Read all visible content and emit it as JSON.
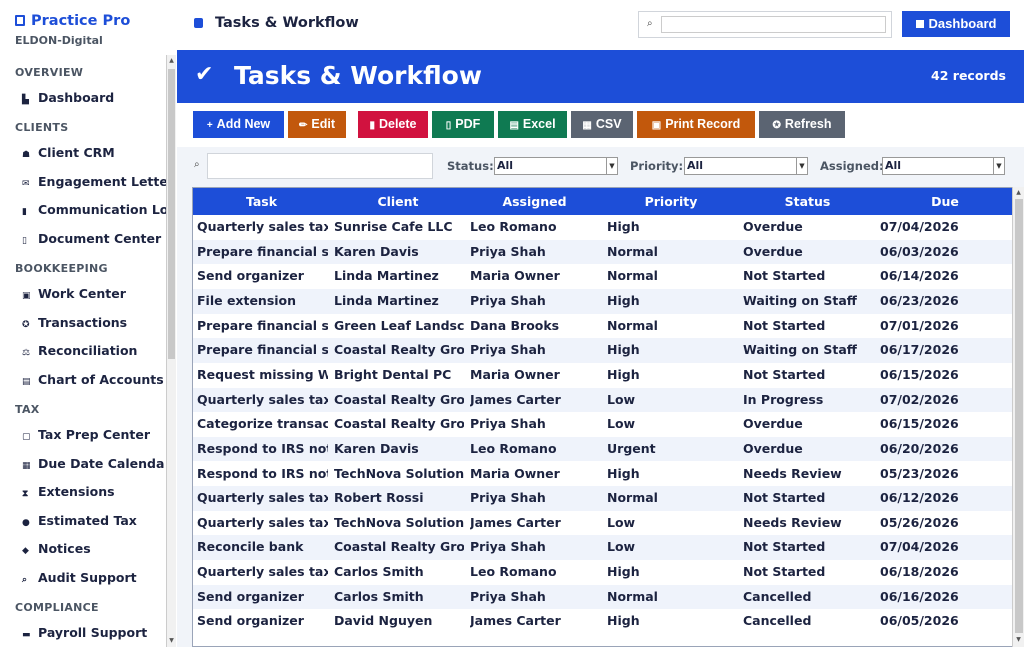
{
  "sidebar": {
    "brand": "Practice Pro",
    "org": "ELDON-Digital",
    "sections": [
      {
        "title": "OVERVIEW",
        "items": [
          {
            "label": "Dashboard",
            "icon": "chart-icon",
            "glyph": "▙"
          }
        ]
      },
      {
        "title": "CLIENTS",
        "items": [
          {
            "label": "Client CRM",
            "icon": "users-icon",
            "glyph": "☗"
          },
          {
            "label": "Engagement Lette",
            "icon": "envelope-icon",
            "glyph": "✉"
          },
          {
            "label": "Communication Lo",
            "icon": "message-icon",
            "glyph": "▮"
          },
          {
            "label": "Document Center",
            "icon": "document-icon",
            "glyph": "▯"
          }
        ]
      },
      {
        "title": "BOOKKEEPING",
        "items": [
          {
            "label": "Work Center",
            "icon": "clipboard-icon",
            "glyph": "▣"
          },
          {
            "label": "Transactions",
            "icon": "exchange-icon",
            "glyph": "✪"
          },
          {
            "label": "Reconciliation",
            "icon": "balance-icon",
            "glyph": "⚖"
          },
          {
            "label": "Chart of Accounts",
            "icon": "book-icon",
            "glyph": "▤"
          }
        ]
      },
      {
        "title": "TAX",
        "items": [
          {
            "label": "Tax Prep Center",
            "icon": "clipboard-icon",
            "glyph": "▢"
          },
          {
            "label": "Due Date Calenda",
            "icon": "calendar-icon",
            "glyph": "▦"
          },
          {
            "label": "Extensions",
            "icon": "hourglass-icon",
            "glyph": "⧗"
          },
          {
            "label": "Estimated Tax",
            "icon": "money-bag-icon",
            "glyph": "●"
          },
          {
            "label": "Notices",
            "icon": "bell-icon",
            "glyph": "◆"
          },
          {
            "label": "Audit Support",
            "icon": "search-icon",
            "glyph": "⌕"
          }
        ]
      },
      {
        "title": "COMPLIANCE",
        "items": [
          {
            "label": "Payroll Support",
            "icon": "briefcase-icon",
            "glyph": "▬"
          }
        ]
      }
    ]
  },
  "topbar": {
    "breadcrumb": "Tasks & Workflow",
    "search_placeholder": "",
    "dashboard_label": "Dashboard"
  },
  "banner": {
    "title": "Tasks & Workflow",
    "records": "42 records"
  },
  "toolbar": {
    "buttons": [
      {
        "label": "Add New",
        "glyph": "+",
        "color": "#1d4ed8"
      },
      {
        "label": "Edit",
        "glyph": "✏",
        "color": "#c2580c"
      },
      {
        "label": "Delete",
        "glyph": "▮",
        "color": "#d1123f"
      },
      {
        "label": "PDF",
        "glyph": "▯",
        "color": "#0f7a52"
      },
      {
        "label": "Excel",
        "glyph": "▤",
        "color": "#0f7a52"
      },
      {
        "label": "CSV",
        "glyph": "▦",
        "color": "#5b6472"
      },
      {
        "label": "Print Record",
        "glyph": "▣",
        "color": "#c2580c"
      },
      {
        "label": "Refresh",
        "glyph": "✪",
        "color": "#5b6472"
      }
    ]
  },
  "filters": {
    "search_value": "",
    "status_label": "Status:",
    "status_value": "All",
    "priority_label": "Priority:",
    "priority_value": "All",
    "assigned_label": "Assigned:",
    "assigned_value": "All"
  },
  "table": {
    "columns": [
      "Task",
      "Client",
      "Assigned",
      "Priority",
      "Status",
      "Due"
    ],
    "rows": [
      [
        "Quarterly sales tax",
        "Sunrise Cafe LLC",
        "Leo Romano",
        "High",
        "Overdue",
        "07/04/2026"
      ],
      [
        "Prepare financial st",
        "Karen Davis",
        "Priya Shah",
        "Normal",
        "Overdue",
        "06/03/2026"
      ],
      [
        "Send organizer",
        "Linda Martinez",
        "Maria Owner",
        "Normal",
        "Not Started",
        "06/14/2026"
      ],
      [
        "File extension",
        "Linda Martinez",
        "Priya Shah",
        "High",
        "Waiting on Staff",
        "06/23/2026"
      ],
      [
        "Prepare financial st",
        "Green Leaf Landsca",
        "Dana Brooks",
        "Normal",
        "Not Started",
        "07/01/2026"
      ],
      [
        "Prepare financial st",
        "Coastal Realty Grou",
        "Priya Shah",
        "High",
        "Waiting on Staff",
        "06/17/2026"
      ],
      [
        "Request missing W-",
        "Bright Dental PC",
        "Maria Owner",
        "High",
        "Not Started",
        "06/15/2026"
      ],
      [
        "Quarterly sales tax",
        "Coastal Realty Grou",
        "James Carter",
        "Low",
        "In Progress",
        "07/02/2026"
      ],
      [
        "Categorize transacti",
        "Coastal Realty Grou",
        "Priya Shah",
        "Low",
        "Overdue",
        "06/15/2026"
      ],
      [
        "Respond to IRS noti",
        "Karen Davis",
        "Leo Romano",
        "Urgent",
        "Overdue",
        "06/20/2026"
      ],
      [
        "Respond to IRS noti",
        "TechNova Solutions",
        "Maria Owner",
        "High",
        "Needs Review",
        "05/23/2026"
      ],
      [
        "Quarterly sales tax",
        "Robert Rossi",
        "Priya Shah",
        "Normal",
        "Not Started",
        "06/12/2026"
      ],
      [
        "Quarterly sales tax",
        "TechNova Solutions",
        "James Carter",
        "Low",
        "Needs Review",
        "05/26/2026"
      ],
      [
        "Reconcile bank",
        "Coastal Realty Grou",
        "Priya Shah",
        "Low",
        "Not Started",
        "07/04/2026"
      ],
      [
        "Quarterly sales tax",
        "Carlos Smith",
        "Leo Romano",
        "High",
        "Not Started",
        "06/18/2026"
      ],
      [
        "Send organizer",
        "Carlos Smith",
        "Priya Shah",
        "Normal",
        "Cancelled",
        "06/16/2026"
      ],
      [
        "Send organizer",
        "David Nguyen",
        "James Carter",
        "High",
        "Cancelled",
        "06/05/2026"
      ]
    ]
  }
}
